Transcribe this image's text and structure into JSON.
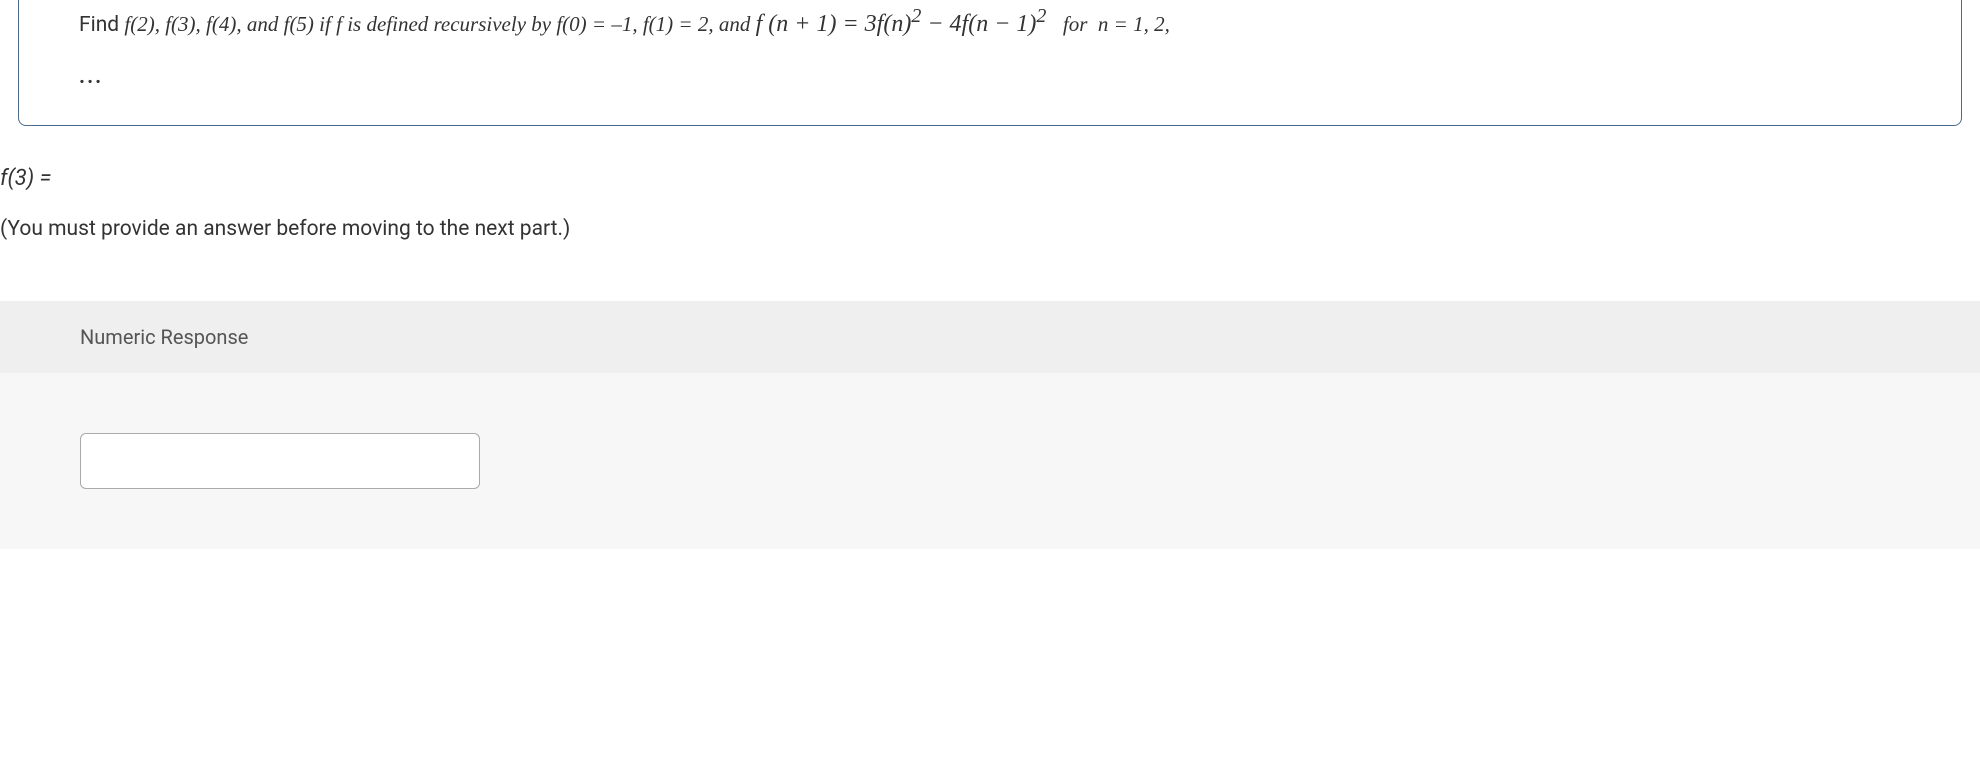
{
  "question": {
    "prefix": "Find ",
    "f2": "f(2), ",
    "f3": "f(3), ",
    "f4": "f(4), and ",
    "f5": "f(5) if ",
    "fdef": "f is defined recursively by ",
    "f0": "f(0) = –1, ",
    "f1": "f(1) = 2, and ",
    "formula": "f (n + 1) = 3f(n)² − 4f(n − 1)²",
    "suffix": "  for  n = 1, 2,",
    "ellipsis": "..."
  },
  "prompt": {
    "label": "f(3) =",
    "hint": "(You must provide an answer before moving to the next part.)"
  },
  "response": {
    "header": "Numeric Response",
    "value": ""
  }
}
